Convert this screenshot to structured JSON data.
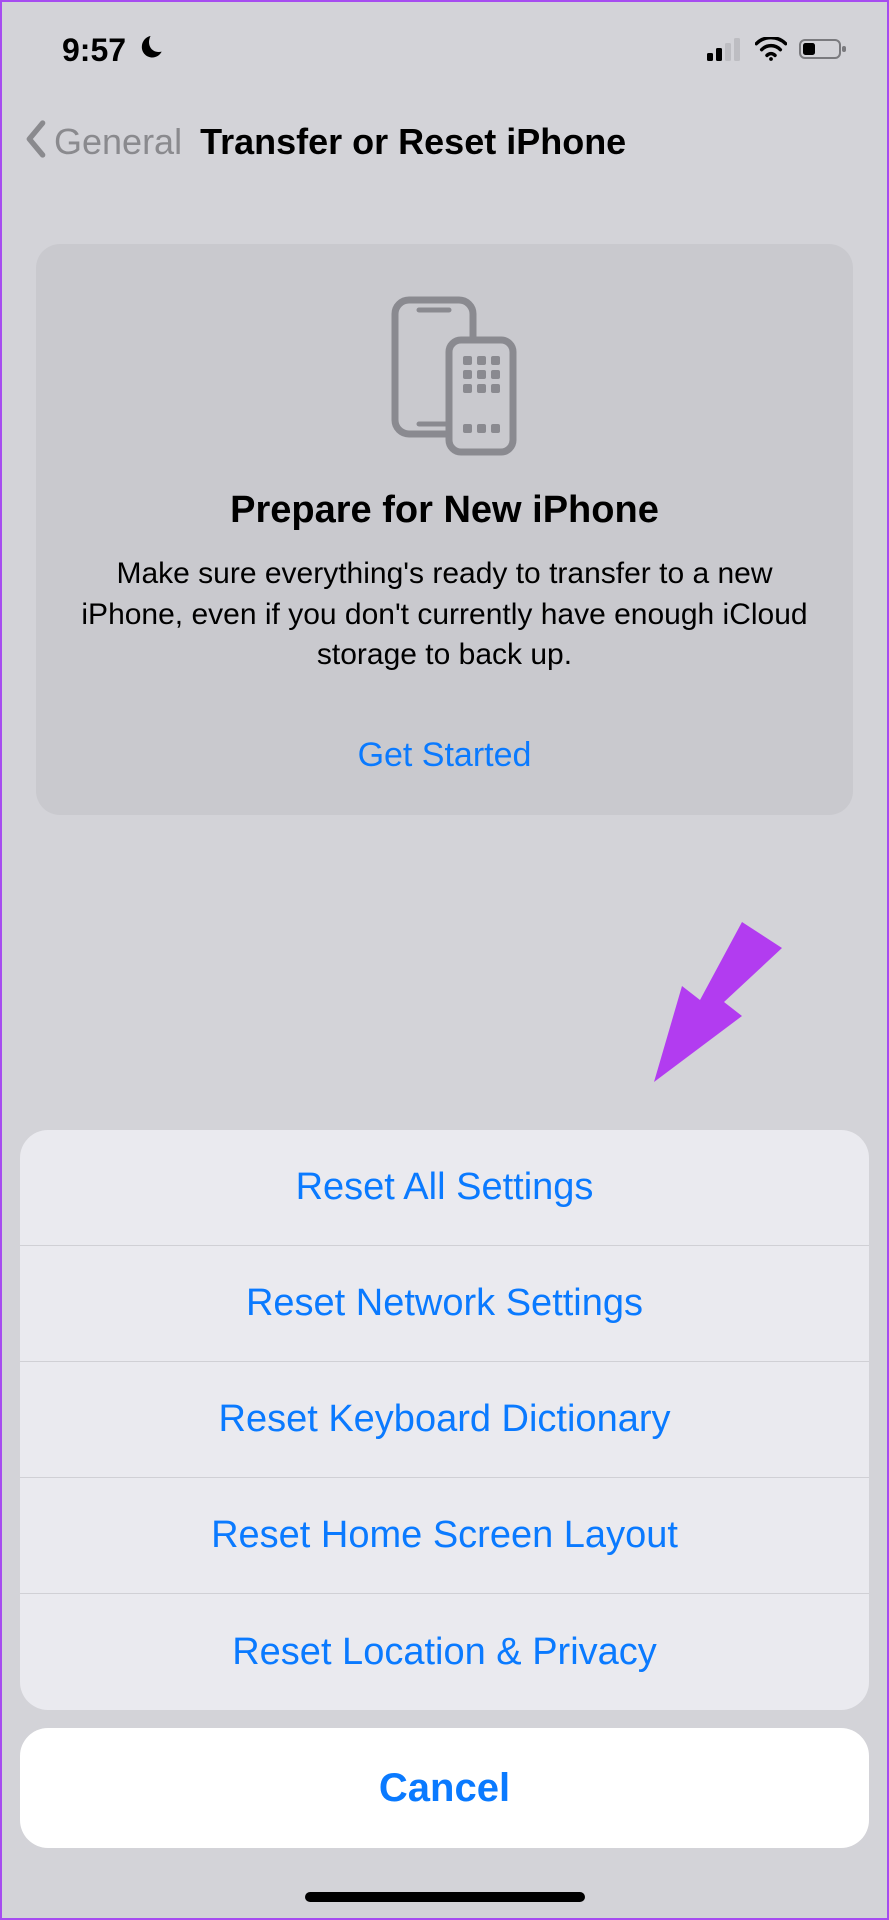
{
  "status": {
    "time": "9:57"
  },
  "nav": {
    "back_label": "General",
    "title": "Transfer or Reset iPhone"
  },
  "hero": {
    "title": "Prepare for New iPhone",
    "body": "Make sure everything's ready to transfer to a new iPhone, even if you don't currently have enough iCloud storage to back up.",
    "cta": "Get Started"
  },
  "sheet": {
    "items": [
      "Reset All Settings",
      "Reset Network Settings",
      "Reset Keyboard Dictionary",
      "Reset Home Screen Layout",
      "Reset Location & Privacy"
    ],
    "cancel": "Cancel"
  },
  "colors": {
    "accent": "#0a7aff",
    "annotation": "#b23cf0"
  }
}
